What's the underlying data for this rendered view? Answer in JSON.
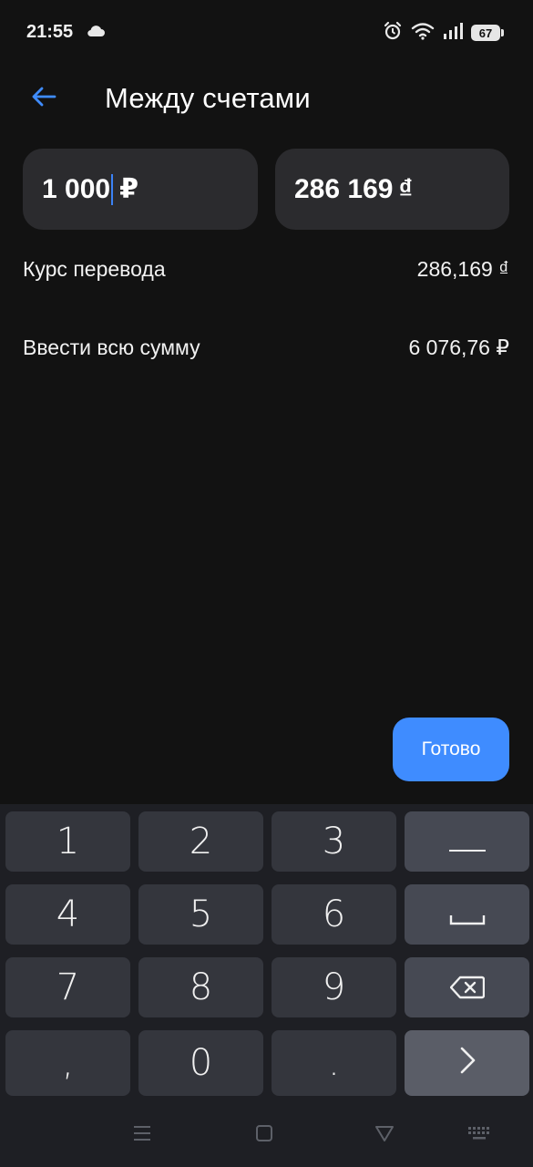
{
  "status_bar": {
    "time": "21:55",
    "battery": "67"
  },
  "header": {
    "title": "Между счетами"
  },
  "transfer": {
    "from_amount": "1 000",
    "from_currency": "₽",
    "to_amount": "286 169",
    "to_currency": "₫"
  },
  "rate_row": {
    "label": "Курс перевода",
    "value": "286,169 ₫"
  },
  "full_amount_row": {
    "label": "Ввести всю сумму",
    "value": "6 076,76 ₽"
  },
  "done_button": {
    "label": "Готово"
  },
  "keyboard": {
    "keys": [
      "1",
      "2",
      "3",
      "4",
      "5",
      "6",
      "7",
      "8",
      "9",
      ",",
      "0",
      "."
    ]
  },
  "colors": {
    "accent": "#3f8cff",
    "background": "#121212",
    "field": "#2b2b2e",
    "key": "#34363d"
  }
}
